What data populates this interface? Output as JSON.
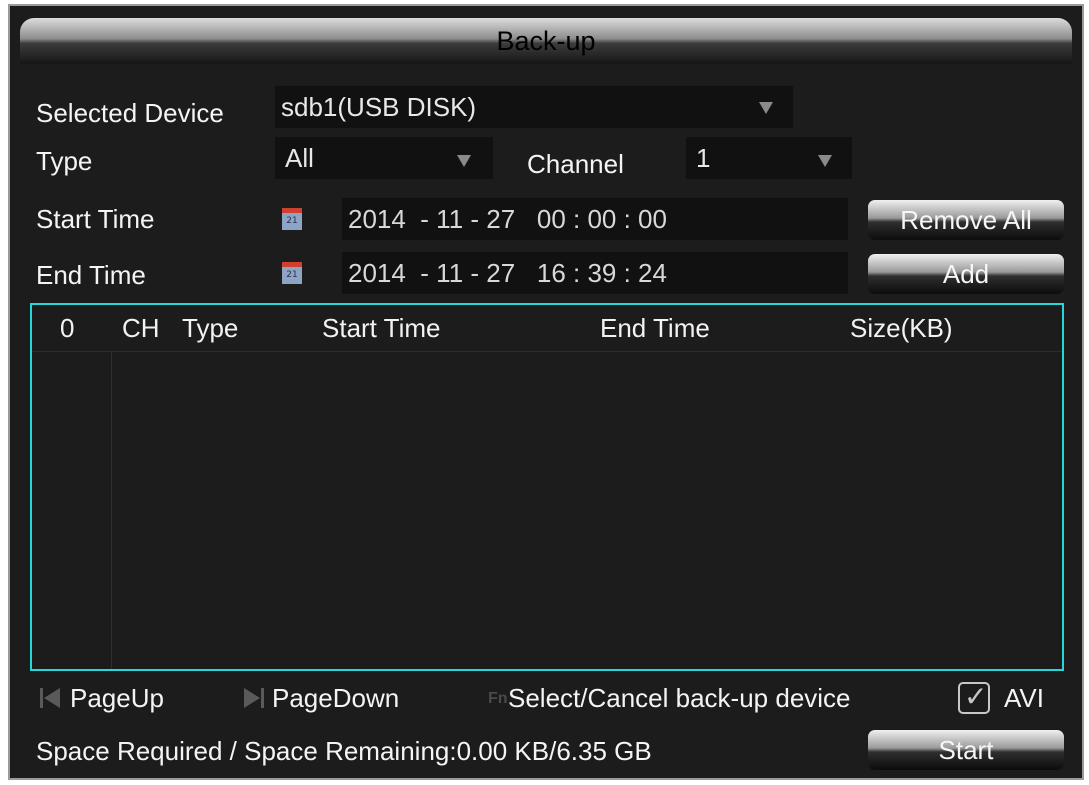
{
  "window": {
    "title": "Back-up"
  },
  "form": {
    "selected_device_label": "Selected Device",
    "selected_device_value": "sdb1(USB DISK)",
    "type_label": "Type",
    "type_value": "All",
    "channel_label": "Channel",
    "channel_value": "1",
    "start_time_label": "Start Time",
    "start_time_value": "2014  - 11 - 27   00 : 00 : 00",
    "end_time_label": "End Time",
    "end_time_value": "2014  - 11 - 27   16 : 39 : 24",
    "calendar_icon_text": "21"
  },
  "buttons": {
    "remove_all": "Remove All",
    "add": "Add",
    "start": "Start"
  },
  "table": {
    "columns": [
      "0",
      "CH",
      "Type",
      "Start Time",
      "End Time",
      "Size(KB)"
    ],
    "rows": []
  },
  "footer": {
    "page_up": "PageUp",
    "page_down": "PageDown",
    "fn_icon": "Fn",
    "select_cancel": "Select/Cancel back-up device",
    "avi_label": "AVI",
    "avi_checked": true,
    "checkmark": "✓",
    "space_info": "Space Required / Space Remaining:0.00 KB/6.35 GB"
  },
  "colors": {
    "list_border": "#26d6d8",
    "background": "#1c1c1c"
  },
  "icons": [
    "calendar-icon",
    "dropdown-arrow-icon",
    "page-up-icon",
    "page-down-icon",
    "fn-key-icon",
    "checkmark-icon"
  ]
}
